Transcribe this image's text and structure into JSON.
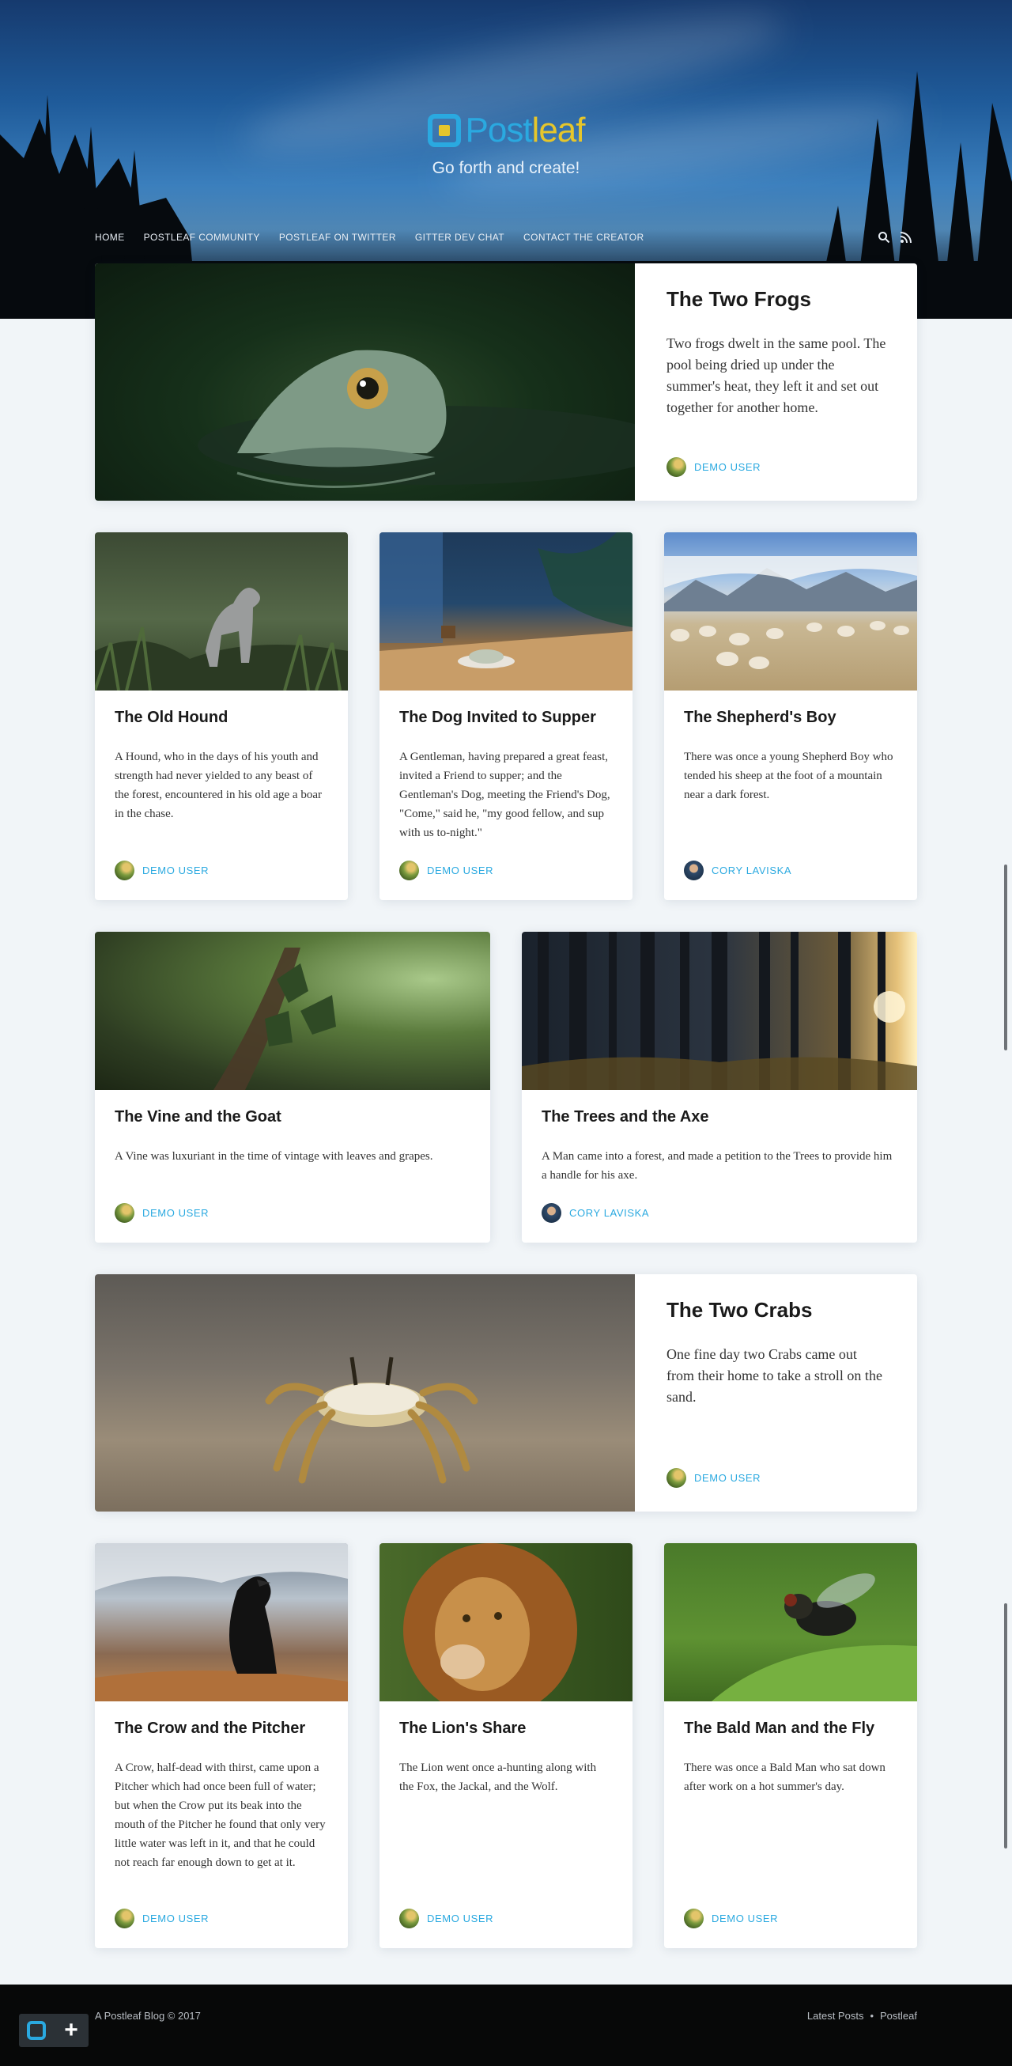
{
  "site": {
    "logo_post": "Post",
    "logo_leaf": "leaf",
    "tagline": "Go forth and create!"
  },
  "nav": {
    "items": [
      "HOME",
      "POSTLEAF COMMUNITY",
      "POSTLEAF ON TWITTER",
      "GITTER DEV CHAT",
      "CONTACT THE CREATOR"
    ],
    "icons": [
      "search-icon",
      "rss-icon"
    ]
  },
  "posts": [
    {
      "title": "The Two Frogs",
      "excerpt": "Two frogs dwelt in the same pool. The pool being dried up under the summer's heat, they left it and set out together for another home.",
      "author": "DEMO USER",
      "image": "frog"
    },
    {
      "title": "The Old Hound",
      "excerpt": "A Hound, who in the days of his youth and strength had never yielded to any beast of the forest, encountered in his old age a boar in the chase.",
      "author": "DEMO USER",
      "image": "dog"
    },
    {
      "title": "The Dog Invited to Supper",
      "excerpt": "A Gentleman, having prepared a great feast, invited a Friend to supper; and the Gentleman's Dog, meeting the Friend's Dog, \"Come,\" said he, \"my good fellow, and sup with us to-night.\"",
      "author": "DEMO USER",
      "image": "supper"
    },
    {
      "title": "The Shepherd's Boy",
      "excerpt": "There was once a young Shepherd Boy who tended his sheep at the foot of a mountain near a dark forest.",
      "author": "CORY LAVISKA",
      "image": "sheep"
    },
    {
      "title": "The Vine and the Goat",
      "excerpt": "A Vine was luxuriant in the time of vintage with leaves and grapes.",
      "author": "DEMO USER",
      "image": "vine"
    },
    {
      "title": "The Trees and the Axe",
      "excerpt": "A Man came into a forest, and made a petition to the Trees to provide him a handle for his axe.",
      "author": "CORY LAVISKA",
      "image": "forest"
    },
    {
      "title": "The Two Crabs",
      "excerpt": "One fine day two Crabs came out from their home to take a stroll on the sand.",
      "author": "DEMO USER",
      "image": "crab"
    },
    {
      "title": "The Crow and the Pitcher",
      "excerpt": "A Crow, half-dead with thirst, came upon a Pitcher which had once been full of water; but when the Crow put its beak into the mouth of the Pitcher he found that only very little water was left in it, and that he could not reach far enough down to get at it.",
      "author": "DEMO USER",
      "image": "crow"
    },
    {
      "title": "The Lion's Share",
      "excerpt": "The Lion went once a-hunting along with the Fox, the Jackal, and the Wolf.",
      "author": "DEMO USER",
      "image": "lion"
    },
    {
      "title": "The Bald Man and the Fly",
      "excerpt": " There was once a Bald Man who sat down after work on a hot summer's day.",
      "author": "DEMO USER",
      "image": "fly"
    }
  ],
  "footer": {
    "copyright": "A Postleaf Blog © 2017",
    "link_latest": "Latest Posts",
    "separator": "•",
    "link_postleaf": "Postleaf"
  },
  "colors": {
    "accent": "#2aa9e0",
    "logo_yellow": "#e6c62b",
    "footer_bg": "#070808",
    "page_bg": "#f1f5f8"
  }
}
